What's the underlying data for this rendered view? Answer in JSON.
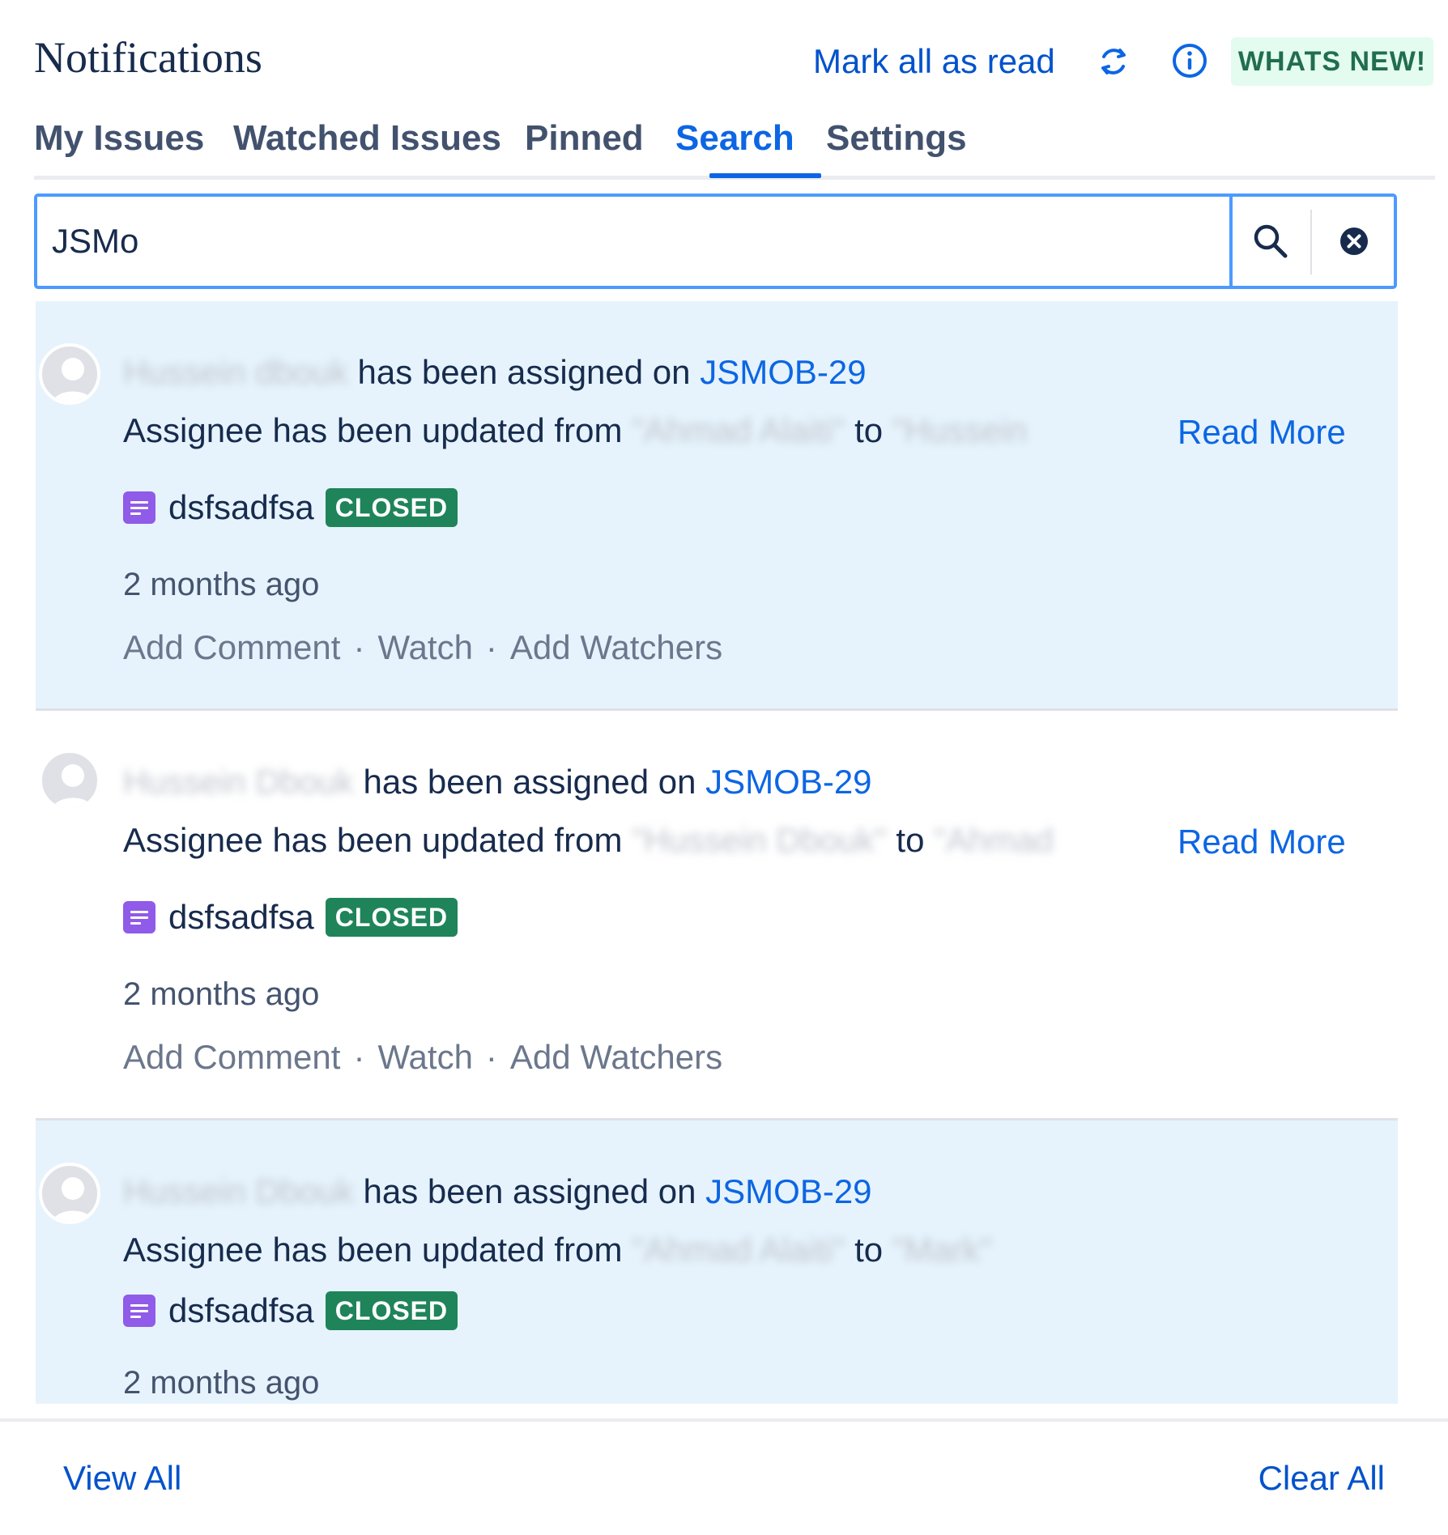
{
  "header": {
    "title": "Notifications",
    "mark_all_read": "Mark all as read",
    "whats_new": "WHATS NEW!",
    "refresh_icon": "refresh-icon",
    "info_icon": "info-icon"
  },
  "tabs": [
    {
      "label": "My Issues",
      "active": false
    },
    {
      "label": "Watched Issues",
      "active": false
    },
    {
      "label": "Pinned",
      "active": false
    },
    {
      "label": "Search",
      "active": true
    },
    {
      "label": "Settings",
      "active": false
    }
  ],
  "search": {
    "value": "JSMo",
    "search_icon": "search-icon",
    "clear_icon": "close-circle-icon"
  },
  "notifications": [
    {
      "actor": "Hussein dbouk",
      "action": "has been assigned on",
      "issue_key": "JSMOB-29",
      "change_text": "Assignee has been updated from",
      "from_value": "\"Ahmad Alaiti\"",
      "to_word": "to",
      "to_value": "\"Hussein",
      "read_more": "Read More",
      "issue_title": "dsfsadfsa",
      "status": "CLOSED",
      "time": "2 months ago",
      "actions": [
        "Add Comment",
        "Watch",
        "Add Watchers"
      ],
      "unread": true
    },
    {
      "actor": "Hussein Dbouk",
      "action": "has been assigned on",
      "issue_key": "JSMOB-29",
      "change_text": "Assignee has been updated from",
      "from_value": "\"Hussein Dbouk\"",
      "to_word": "to",
      "to_value": "\"Ahmad",
      "read_more": "Read More",
      "issue_title": "dsfsadfsa",
      "status": "CLOSED",
      "time": "2 months ago",
      "actions": [
        "Add Comment",
        "Watch",
        "Add Watchers"
      ],
      "unread": false
    },
    {
      "actor": "Hussein Dbouk",
      "action": "has been assigned on",
      "issue_key": "JSMOB-29",
      "change_text": "Assignee has been updated from",
      "from_value": "\"Ahmad Alaiti\"",
      "to_word": "to",
      "to_value": "\"Mark\"",
      "read_more": "",
      "issue_title": "dsfsadfsa",
      "status": "CLOSED",
      "time": "2 months ago",
      "actions": [],
      "unread": true
    }
  ],
  "footer": {
    "view_all": "View All",
    "clear_all": "Clear All"
  },
  "colors": {
    "link": "#0c66e4",
    "unread_bg": "#e6f3fc",
    "status_closed": "#1f845a",
    "whats_new_bg": "#e3fcef"
  }
}
